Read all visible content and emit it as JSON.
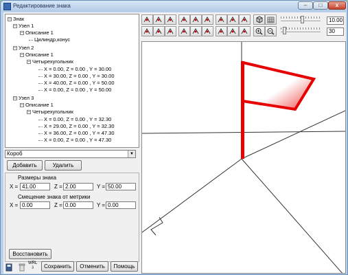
{
  "window": {
    "title": "Редактирование знака",
    "min": "–",
    "max": "□",
    "close": "x"
  },
  "tree": {
    "root": "Знак",
    "node1": "Узел 1",
    "node1_desc": "Описание 1",
    "node1_shape": "Цилиндр,конус",
    "node2": "Узел 2",
    "node2_desc": "Описание 1",
    "node2_shape": "Четырехугольник",
    "node2_pts": [
      "X = 0.00,  Z = 0.00 ,  Y = 30.00",
      "X = 30.00,  Z = 0.00 ,  Y = 30.00",
      "X = 40.00,  Z = 0.00 ,  Y = 50.00",
      "X = 0.00,  Z = 0.00 ,  Y = 50.00"
    ],
    "node3": "Узел 3",
    "node3_desc": "Описание 1",
    "node3_shape": "Четырехугольник",
    "node3_pts": [
      "X = 0.00,  Z = 0.00 ,  Y = 32.30",
      "X = 29.00,  Z = 0.00 ,  Y = 32.30",
      "X = 36.00,  Z = 0.00 ,  Y = 47.30",
      "X = 0.00,  Z = 0.00 ,  Y = 47.30"
    ]
  },
  "combo": {
    "value": "Короб"
  },
  "buttons": {
    "add": "Добавить",
    "delete": "Удалить",
    "restore": "Восстановить",
    "save": "Сохранить",
    "cancel": "Отменить",
    "help": "Помощь"
  },
  "size": {
    "title": "Размеры знака",
    "x_label": "X =",
    "z_label": "Z =",
    "y_label": "Y =",
    "x": "41.00",
    "z": "2.00",
    "y": "50.00"
  },
  "offset": {
    "title": "Смещение знака от метрики",
    "x_label": "X =",
    "z_label": "Z =",
    "y_label": "Y =",
    "x": "0.00",
    "z": "0.00",
    "y": "0.00"
  },
  "toolbar": {
    "value1": "10.00",
    "value2": "30",
    "wrl": "WRL"
  },
  "sliders": {
    "slider1_level": 0.55,
    "slider2_level": 0.05
  },
  "icons": {
    "save_icon": "floppy-icon",
    "trash_icon": "trash-icon",
    "wrl_icon": "wrl-export-icon"
  },
  "colors": {
    "flag": "#e60000",
    "axis": "#333333"
  }
}
